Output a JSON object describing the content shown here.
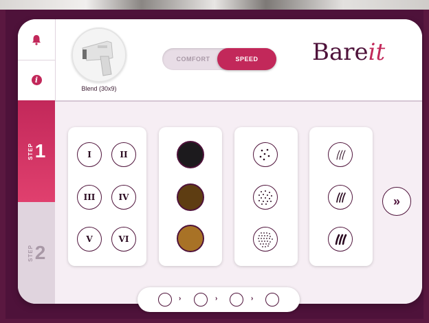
{
  "header": {
    "handpiece_label": "Blend (30x9)",
    "modes": [
      {
        "label": "COMFORT",
        "selected": false
      },
      {
        "label": "SPEED",
        "selected": true
      }
    ],
    "brand_main": "Bare",
    "brand_accent": "it"
  },
  "sidebar": {
    "icons": [
      "bell-icon",
      "info-icon"
    ],
    "info_glyph": "i"
  },
  "steps": [
    {
      "word": "STEP",
      "number": "1",
      "active": true
    },
    {
      "word": "STEP",
      "number": "2",
      "active": false
    }
  ],
  "skin_types": [
    "I",
    "II",
    "III",
    "IV",
    "V",
    "VI"
  ],
  "hair_colors": [
    "#1c1a1d",
    "#5e3d12",
    "#a87226"
  ],
  "density_icons": [
    "low-density-icon",
    "medium-density-icon",
    "high-density-icon"
  ],
  "thickness_icons": [
    "fine-hair-icon",
    "medium-hair-icon",
    "thick-hair-icon"
  ],
  "next_glyph": "»",
  "progress": {
    "dots": 4,
    "arrow_glyph": "›"
  },
  "colors": {
    "accent": "#c2285a",
    "dark": "#4e123a",
    "background": "#5a1840"
  }
}
